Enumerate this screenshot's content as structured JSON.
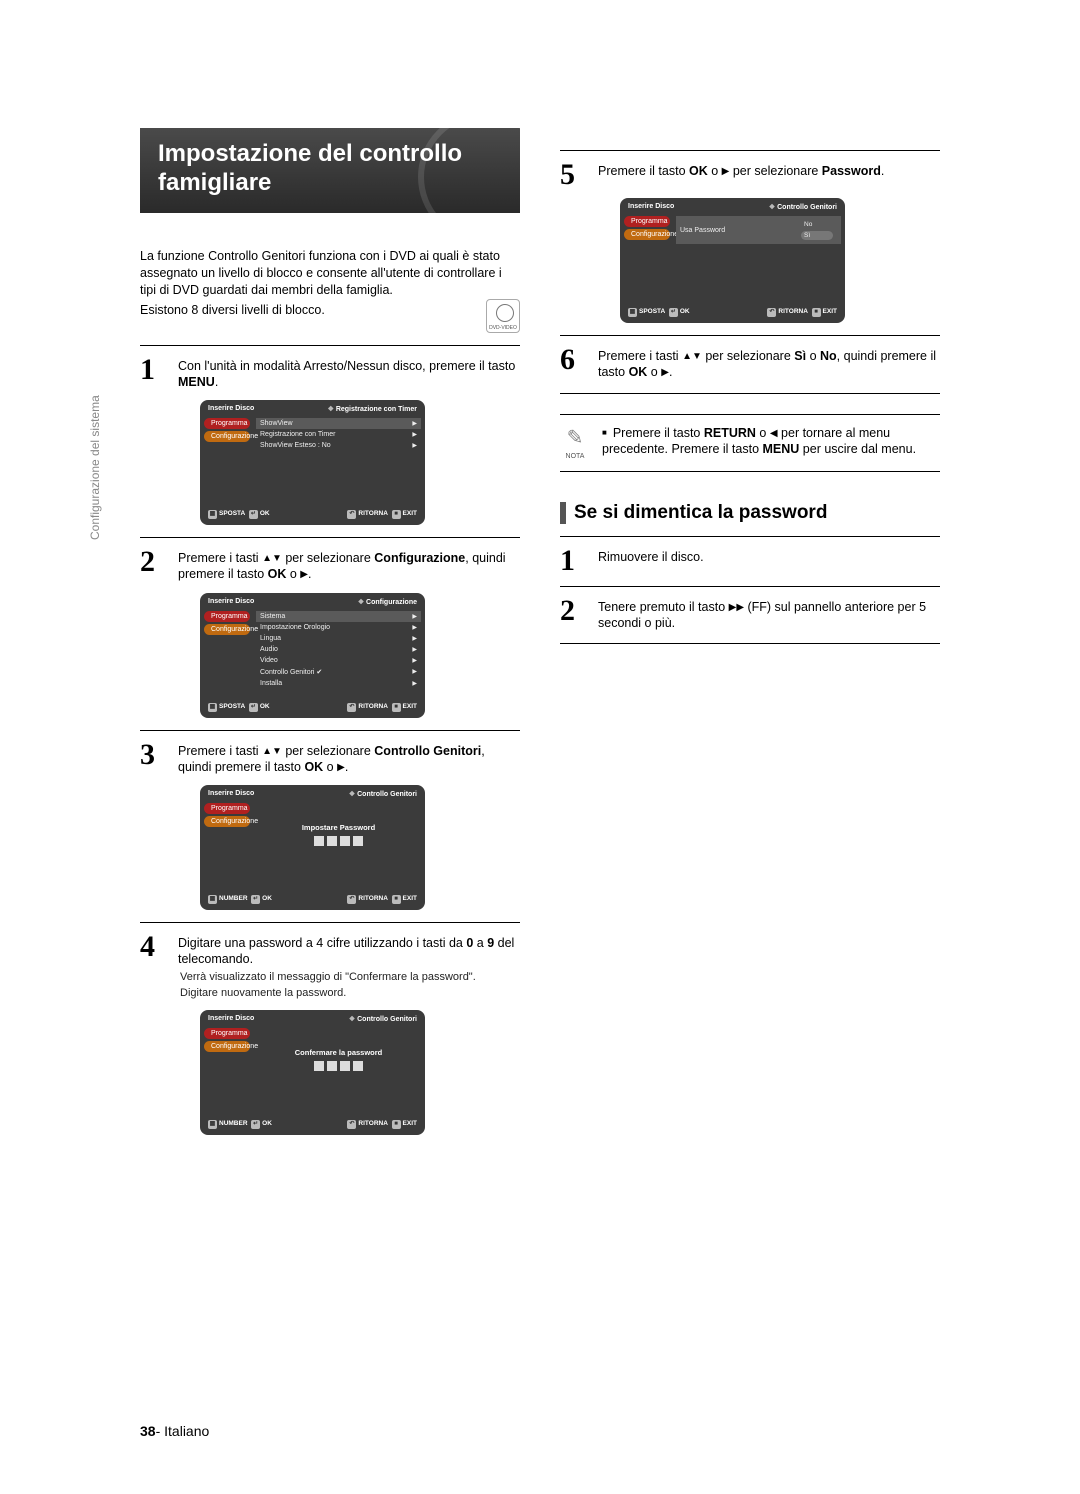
{
  "side_label": "Configurazione del sistema",
  "title_line1": "Impostazione del controllo",
  "title_line2": "famigliare",
  "intro": "La funzione Controllo Genitori  funziona con i DVD ai quali è stato assegnato un livello di blocco e consente all'utente di controllare i tipi di DVD guardati dai membri della famiglia.",
  "levels": "Esistono 8 diversi livelli di blocco.",
  "dvd_badge": "DVD-VIDEO",
  "step1": {
    "num": "1",
    "text_a": "Con l'unità in modalità Arresto/Nessun disco, premere il tasto ",
    "text_b": "MENU",
    "text_c": "."
  },
  "step2": {
    "num": "2",
    "text_a": "Premere i tasti ",
    "arrows": "▲▼",
    "text_b": " per selezionare ",
    "bold1": "Configurazione",
    "text_c": ", quindi premere il tasto ",
    "bold2": "OK",
    "text_d": " o ",
    "arrow_r": "▶",
    "text_e": "."
  },
  "step3": {
    "num": "3",
    "text_a": "Premere i tasti ",
    "arrows": "▲▼",
    "text_b": " per selezionare ",
    "bold1": "Controllo Genitori",
    "text_c": ", quindi premere il tasto ",
    "bold2": "OK",
    "text_d": " o ",
    "arrow_r": "▶",
    "text_e": "."
  },
  "step4": {
    "num": "4",
    "text_a": "Digitare una password a 4 cifre utilizzando i tasti da ",
    "bold1": "0",
    "text_b": " a ",
    "bold2": "9",
    "text_c": " del telecomando.",
    "sub1": "Verrà visualizzato il messaggio di \"Confermare la password\".",
    "sub2": "Digitare nuovamente la password."
  },
  "step5": {
    "num": "5",
    "text_a": "Premere il tasto ",
    "bold1": "OK",
    "text_b": " o ",
    "arrow_r": "▶",
    "text_c": " per selezionare ",
    "bold2": "Password",
    "text_d": "."
  },
  "step6": {
    "num": "6",
    "text_a": "Premere i tasti ",
    "arrows": "▲▼",
    "text_b": " per selezionare ",
    "bold1": "Sì",
    "text_c": " o ",
    "bold2": "No",
    "text_d": ", quindi premere il tasto ",
    "bold3": "OK",
    "text_e": " o ",
    "arrow_r": "▶",
    "text_f": "."
  },
  "note": {
    "label": "NOTA",
    "text_a": "Premere il tasto ",
    "bold1": "RETURN",
    "text_b": " o ",
    "arrow_l": "◀",
    "text_c": " per tornare al menu precedente. Premere il tasto ",
    "bold2": "MENU",
    "text_d": " per uscire dal menu."
  },
  "subhead": "Se si dimentica la password",
  "stepA": {
    "num": "1",
    "text": "Rimuovere il disco."
  },
  "stepB": {
    "num": "2",
    "text_a": "Tenere premuto il tasto ",
    "ff": "▶▶",
    "text_b": " (FF) sul pannello anteriore per 5 secondi o più."
  },
  "osd_common": {
    "inserire": "Inserire Disco",
    "programma": "Programma",
    "configurazione": "Configurazione",
    "foot_sposta": "SPOSTA",
    "foot_ok": "OK",
    "foot_ritorna": "RITORNA",
    "foot_exit": "EXIT",
    "foot_number": "NUMBER"
  },
  "osd1": {
    "crumb": "Registrazione con Timer",
    "rows": [
      "ShowView",
      "Registrazione con Timer",
      "ShowView Esteso : No"
    ]
  },
  "osd2": {
    "crumb": "Configurazione",
    "rows": [
      "Sistema",
      "Impostazione Orologio",
      "Lingua",
      "Audio",
      "Video",
      "Controllo Genitori ✔",
      "Installa"
    ]
  },
  "osd3": {
    "crumb": "Controllo Genitori",
    "center": "Impostare Password"
  },
  "osd4": {
    "crumb": "Controllo Genitori",
    "center": "Confermare la password"
  },
  "osd5": {
    "crumb": "Controllo Genitori",
    "row": "Usa Password",
    "opts": [
      "No",
      "Sì"
    ]
  },
  "footer": {
    "page": "38",
    "lang": "Italiano"
  }
}
